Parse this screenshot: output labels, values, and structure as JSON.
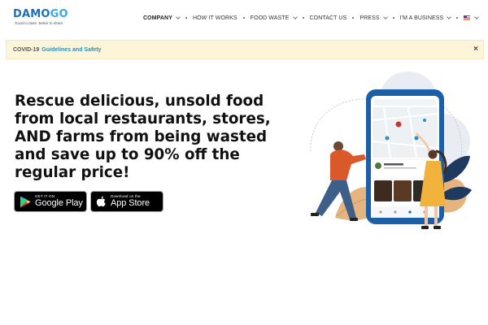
{
  "brand": {
    "name_part1": "DAMO",
    "name_part2": "GO",
    "tagline": "Good to taste. Better to share.",
    "primary_color": "#1c6fb5",
    "accent_color": "#36a9e1"
  },
  "nav": {
    "items": [
      {
        "label": "COMPANY",
        "has_dropdown": true
      },
      {
        "label": "HOW IT WORKS",
        "has_dropdown": false
      },
      {
        "label": "FOOD WASTE",
        "has_dropdown": true
      },
      {
        "label": "CONTACT US",
        "has_dropdown": false
      },
      {
        "label": "PRESS",
        "has_dropdown": true
      },
      {
        "label": "I'M A BUSINESS",
        "has_dropdown": true
      }
    ],
    "language_icon": "us-flag-icon"
  },
  "covid_banner": {
    "label": "COVID-19",
    "link": "Guidelines and Safety",
    "close": "×",
    "background": "#fdf5d9"
  },
  "hero": {
    "headline": "Rescue delicious, unsold food from local restaurants, stores, AND farms from being wasted and save up to 90% off the regular price!"
  },
  "store_buttons": {
    "google": {
      "small": "GET IT ON",
      "big": "Google Play",
      "icon": "google-play-icon"
    },
    "apple": {
      "small": "Download on the",
      "big": "App Store",
      "icon": "apple-icon"
    }
  },
  "illustration": {
    "phone_search_placeholder": "Search restaurants, foods, etc here",
    "card_title": "Burger House"
  }
}
